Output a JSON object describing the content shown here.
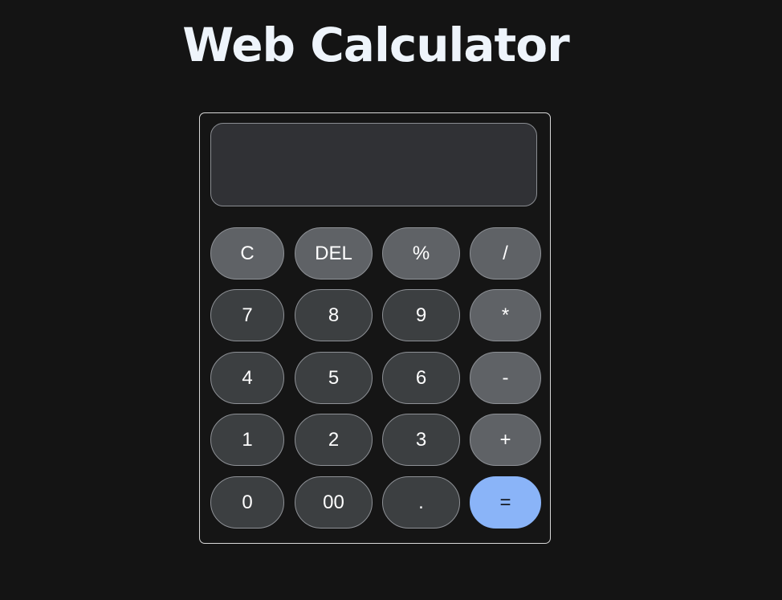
{
  "page": {
    "title": "Web Calculator"
  },
  "display": {
    "value": ""
  },
  "buttons": {
    "clear": "C",
    "delete": "DEL",
    "percent": "%",
    "divide": "/",
    "seven": "7",
    "eight": "8",
    "nine": "9",
    "multiply": "*",
    "four": "4",
    "five": "5",
    "six": "6",
    "subtract": "-",
    "one": "1",
    "two": "2",
    "three": "3",
    "add": "+",
    "zero": "0",
    "double_zero": "00",
    "decimal": ".",
    "equals": "="
  },
  "colors": {
    "background": "#141414",
    "display_bg": "#303135",
    "number_button": "#3c3f41",
    "operator_button": "#5f6266",
    "equals_button": "#8ab4f8",
    "title_text": "#eef4fb"
  }
}
